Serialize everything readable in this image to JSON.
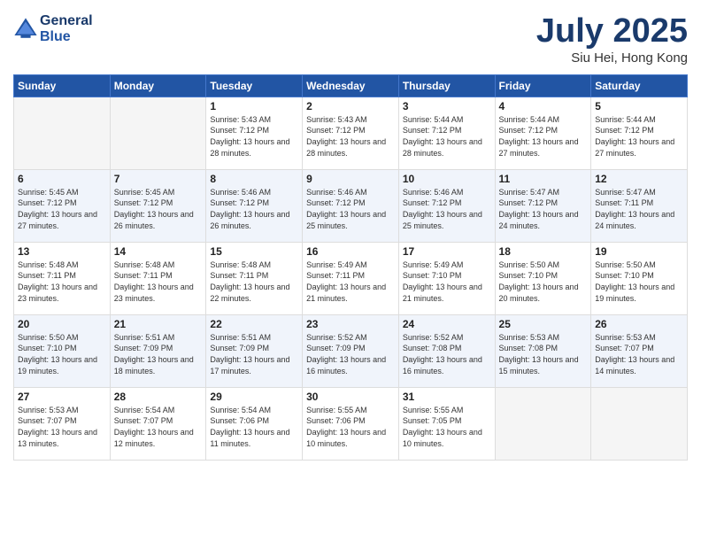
{
  "header": {
    "logo_line1": "General",
    "logo_line2": "Blue",
    "month": "July 2025",
    "location": "Siu Hei, Hong Kong"
  },
  "weekdays": [
    "Sunday",
    "Monday",
    "Tuesday",
    "Wednesday",
    "Thursday",
    "Friday",
    "Saturday"
  ],
  "weeks": [
    [
      {
        "day": "",
        "info": ""
      },
      {
        "day": "",
        "info": ""
      },
      {
        "day": "1",
        "info": "Sunrise: 5:43 AM\nSunset: 7:12 PM\nDaylight: 13 hours and 28 minutes."
      },
      {
        "day": "2",
        "info": "Sunrise: 5:43 AM\nSunset: 7:12 PM\nDaylight: 13 hours and 28 minutes."
      },
      {
        "day": "3",
        "info": "Sunrise: 5:44 AM\nSunset: 7:12 PM\nDaylight: 13 hours and 28 minutes."
      },
      {
        "day": "4",
        "info": "Sunrise: 5:44 AM\nSunset: 7:12 PM\nDaylight: 13 hours and 27 minutes."
      },
      {
        "day": "5",
        "info": "Sunrise: 5:44 AM\nSunset: 7:12 PM\nDaylight: 13 hours and 27 minutes."
      }
    ],
    [
      {
        "day": "6",
        "info": "Sunrise: 5:45 AM\nSunset: 7:12 PM\nDaylight: 13 hours and 27 minutes."
      },
      {
        "day": "7",
        "info": "Sunrise: 5:45 AM\nSunset: 7:12 PM\nDaylight: 13 hours and 26 minutes."
      },
      {
        "day": "8",
        "info": "Sunrise: 5:46 AM\nSunset: 7:12 PM\nDaylight: 13 hours and 26 minutes."
      },
      {
        "day": "9",
        "info": "Sunrise: 5:46 AM\nSunset: 7:12 PM\nDaylight: 13 hours and 25 minutes."
      },
      {
        "day": "10",
        "info": "Sunrise: 5:46 AM\nSunset: 7:12 PM\nDaylight: 13 hours and 25 minutes."
      },
      {
        "day": "11",
        "info": "Sunrise: 5:47 AM\nSunset: 7:12 PM\nDaylight: 13 hours and 24 minutes."
      },
      {
        "day": "12",
        "info": "Sunrise: 5:47 AM\nSunset: 7:11 PM\nDaylight: 13 hours and 24 minutes."
      }
    ],
    [
      {
        "day": "13",
        "info": "Sunrise: 5:48 AM\nSunset: 7:11 PM\nDaylight: 13 hours and 23 minutes."
      },
      {
        "day": "14",
        "info": "Sunrise: 5:48 AM\nSunset: 7:11 PM\nDaylight: 13 hours and 23 minutes."
      },
      {
        "day": "15",
        "info": "Sunrise: 5:48 AM\nSunset: 7:11 PM\nDaylight: 13 hours and 22 minutes."
      },
      {
        "day": "16",
        "info": "Sunrise: 5:49 AM\nSunset: 7:11 PM\nDaylight: 13 hours and 21 minutes."
      },
      {
        "day": "17",
        "info": "Sunrise: 5:49 AM\nSunset: 7:10 PM\nDaylight: 13 hours and 21 minutes."
      },
      {
        "day": "18",
        "info": "Sunrise: 5:50 AM\nSunset: 7:10 PM\nDaylight: 13 hours and 20 minutes."
      },
      {
        "day": "19",
        "info": "Sunrise: 5:50 AM\nSunset: 7:10 PM\nDaylight: 13 hours and 19 minutes."
      }
    ],
    [
      {
        "day": "20",
        "info": "Sunrise: 5:50 AM\nSunset: 7:10 PM\nDaylight: 13 hours and 19 minutes."
      },
      {
        "day": "21",
        "info": "Sunrise: 5:51 AM\nSunset: 7:09 PM\nDaylight: 13 hours and 18 minutes."
      },
      {
        "day": "22",
        "info": "Sunrise: 5:51 AM\nSunset: 7:09 PM\nDaylight: 13 hours and 17 minutes."
      },
      {
        "day": "23",
        "info": "Sunrise: 5:52 AM\nSunset: 7:09 PM\nDaylight: 13 hours and 16 minutes."
      },
      {
        "day": "24",
        "info": "Sunrise: 5:52 AM\nSunset: 7:08 PM\nDaylight: 13 hours and 16 minutes."
      },
      {
        "day": "25",
        "info": "Sunrise: 5:53 AM\nSunset: 7:08 PM\nDaylight: 13 hours and 15 minutes."
      },
      {
        "day": "26",
        "info": "Sunrise: 5:53 AM\nSunset: 7:07 PM\nDaylight: 13 hours and 14 minutes."
      }
    ],
    [
      {
        "day": "27",
        "info": "Sunrise: 5:53 AM\nSunset: 7:07 PM\nDaylight: 13 hours and 13 minutes."
      },
      {
        "day": "28",
        "info": "Sunrise: 5:54 AM\nSunset: 7:07 PM\nDaylight: 13 hours and 12 minutes."
      },
      {
        "day": "29",
        "info": "Sunrise: 5:54 AM\nSunset: 7:06 PM\nDaylight: 13 hours and 11 minutes."
      },
      {
        "day": "30",
        "info": "Sunrise: 5:55 AM\nSunset: 7:06 PM\nDaylight: 13 hours and 10 minutes."
      },
      {
        "day": "31",
        "info": "Sunrise: 5:55 AM\nSunset: 7:05 PM\nDaylight: 13 hours and 10 minutes."
      },
      {
        "day": "",
        "info": ""
      },
      {
        "day": "",
        "info": ""
      }
    ]
  ]
}
